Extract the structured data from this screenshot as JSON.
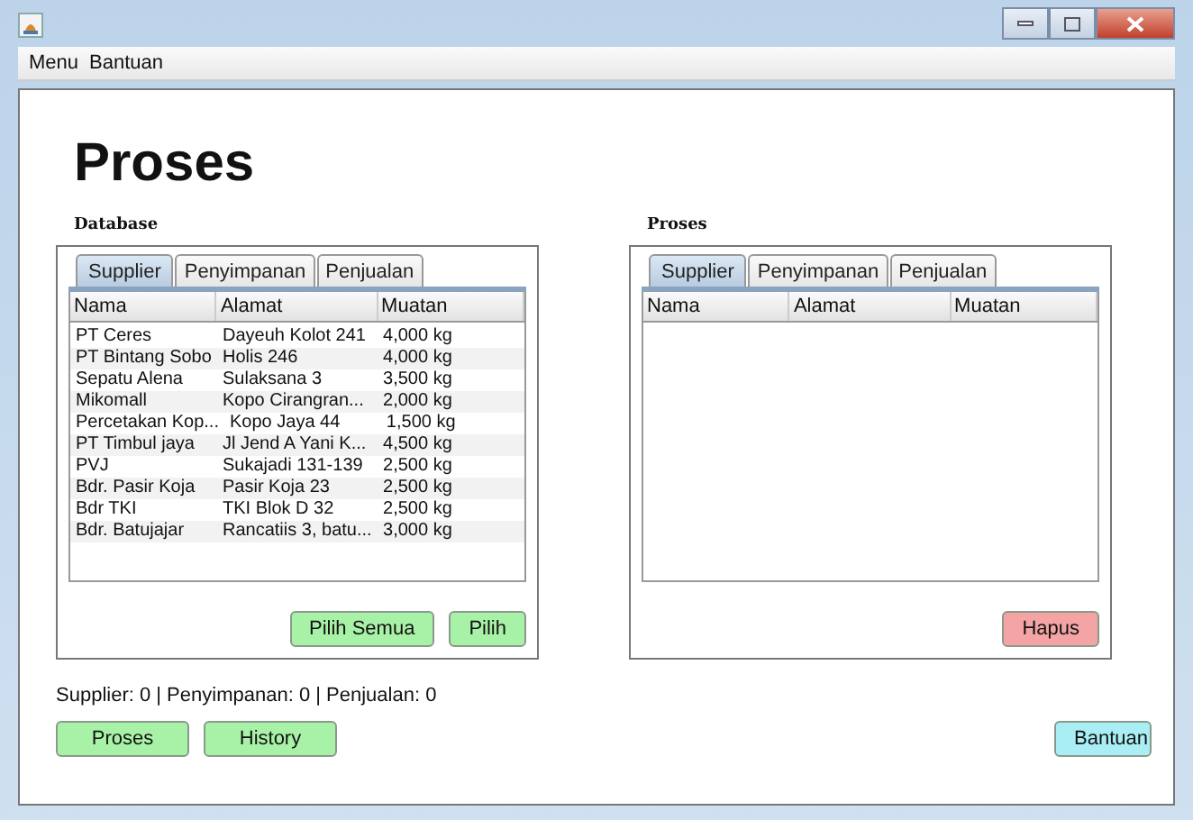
{
  "menu_bar": [
    "Menu",
    "Bantuan"
  ],
  "heading": "Proses",
  "panels": [
    {
      "label": "Database",
      "tabs": [
        {
          "label": "Supplier",
          "selected": true
        },
        {
          "label": "Penyimpanan",
          "selected": false
        },
        {
          "label": "Penjualan",
          "selected": false
        }
      ],
      "columns": [
        "Nama",
        "Alamat",
        "Muatan"
      ],
      "rows": [
        [
          "PT Ceres",
          "Dayeuh Kolot 241",
          "4,000 kg"
        ],
        [
          "PT Bintang Sobo",
          "Holis 246",
          "4,000 kg"
        ],
        [
          "Sepatu Alena",
          "Sulaksana 3",
          "3,500 kg"
        ],
        [
          "Mikomall",
          "Kopo Cirangran...",
          "2,000 kg"
        ],
        [
          "Percetakan Kop...",
          "Kopo Jaya 44",
          "1,500 kg"
        ],
        [
          "PT Timbul jaya",
          "Jl Jend A Yani K...",
          "4,500 kg"
        ],
        [
          "PVJ",
          "Sukajadi 131-139",
          "2,500 kg"
        ],
        [
          "Bdr. Pasir Koja",
          "Pasir Koja 23",
          "2,500 kg"
        ],
        [
          "Bdr TKI",
          "TKI Blok D 32",
          "2,500 kg"
        ],
        [
          "Bdr. Batujajar",
          "Rancatiis 3, batu...",
          "3,000 kg"
        ]
      ],
      "buttons": [
        {
          "label": "Pilih Semua",
          "kind": "confirm"
        },
        {
          "label": "Pilih",
          "kind": "confirm"
        }
      ]
    },
    {
      "label": "Proses",
      "tabs": [
        {
          "label": "Supplier",
          "selected": true
        },
        {
          "label": "Penyimpanan",
          "selected": false
        },
        {
          "label": "Penjualan",
          "selected": false
        }
      ],
      "columns": [
        "Nama",
        "Alamat",
        "Muatan"
      ],
      "buttons": [
        {
          "label": "Hapus",
          "kind": "danger"
        }
      ]
    }
  ],
  "summary": "Supplier: 0 | Penyimpanan: 0 | Penjualan: 0",
  "footer_buttons": [
    {
      "label": "Proses",
      "kind": "confirm"
    },
    {
      "label": "History",
      "kind": "confirm"
    },
    {
      "label": "Bantuan",
      "kind": "help"
    }
  ]
}
